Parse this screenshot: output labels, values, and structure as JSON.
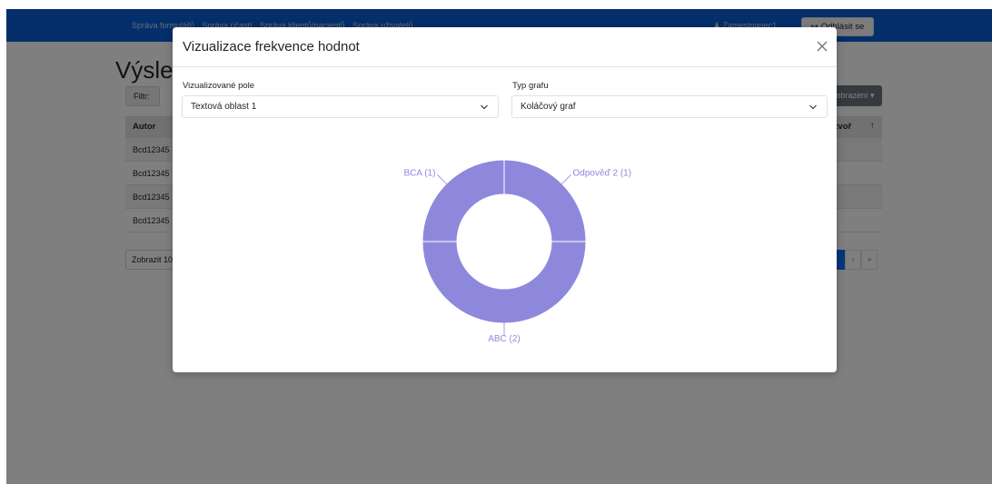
{
  "navbar": {
    "links": [
      "Správa formulářů",
      "Správa účastí",
      "Správa klientů/pacientů",
      "Správa uživatelů"
    ],
    "user": "Zamestnanec1",
    "logout_label": "Odhlásit se"
  },
  "page": {
    "title": "Výsledky",
    "filter_label": "Filtr:",
    "view_button": "Zobrazení",
    "table": {
      "headers": [
        "Autor",
        "Vytvoř"
      ],
      "rows": [
        "Bcd12345",
        "Bcd12345",
        "Bcd12345",
        "Bcd12345"
      ]
    },
    "show_label": "Zobrazit 10"
  },
  "modal": {
    "title": "Vizualizace frekvence hodnot",
    "field": {
      "label": "Vizualizované pole",
      "value": "Textová oblast 1"
    },
    "chart_type": {
      "label": "Typ grafu",
      "value": "Koláčový graf"
    }
  },
  "colors": {
    "navbar": "#0b5ed7",
    "slice": "#8e88dd",
    "slice_label": "#8e88dd"
  },
  "chart_data": {
    "type": "pie",
    "style": "donut",
    "categories": [
      "Odpověď 2",
      "ABC",
      "BCA"
    ],
    "values": [
      1,
      2,
      1
    ],
    "labels": [
      "Odpověď 2 (1)",
      "ABC (2)",
      "BCA (1)"
    ]
  }
}
